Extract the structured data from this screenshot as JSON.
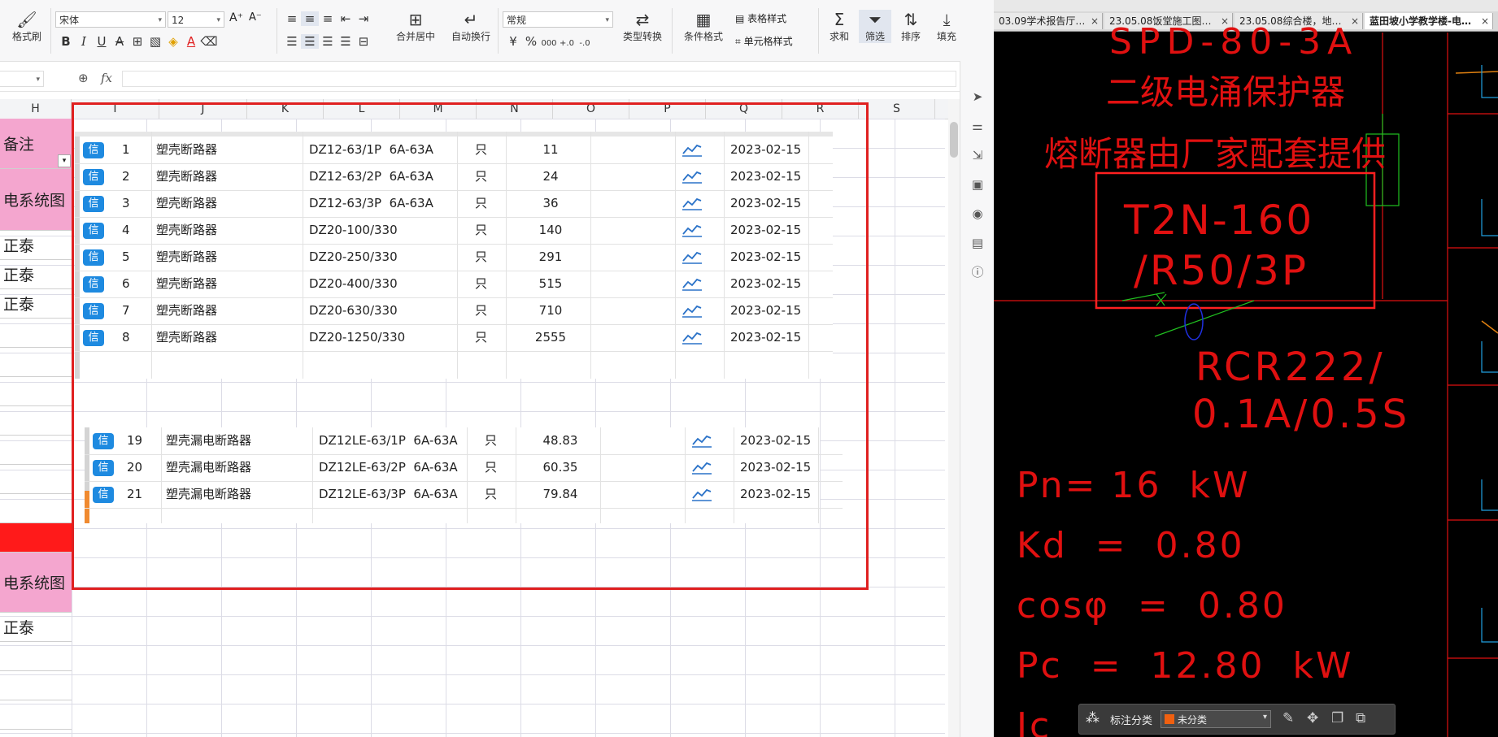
{
  "toolbar": {
    "format_painter": "格式刷",
    "font_name": "宋体",
    "font_size": "12",
    "number_format": "常规",
    "merge_center": "合并居中",
    "wrap_text": "自动换行",
    "type_convert": "类型转换",
    "conditional_format": "条件格式",
    "table_style": "表格样式",
    "cell_style": "单元格样式",
    "sum": "求和",
    "filter": "筛选",
    "sort": "排序",
    "fill": "填充",
    "percent": "%",
    "thousands": "000",
    "fx": "fx"
  },
  "columns": [
    "H",
    "I",
    "J",
    "K",
    "L",
    "M",
    "N",
    "O",
    "P",
    "Q",
    "R",
    "S"
  ],
  "h_column": [
    "备注",
    "电系统图",
    "正泰",
    "正泰",
    "正泰",
    "",
    "",
    "",
    "",
    "",
    "",
    "",
    "",
    "电系统图",
    "正泰"
  ],
  "table_top": {
    "rows": [
      {
        "no": "1",
        "name": "塑壳断路器",
        "model": "DZ12-63/1P  6A-63A",
        "unit": "只",
        "price": "11",
        "date": "2023-02-15"
      },
      {
        "no": "2",
        "name": "塑壳断路器",
        "model": "DZ12-63/2P  6A-63A",
        "unit": "只",
        "price": "24",
        "date": "2023-02-15"
      },
      {
        "no": "3",
        "name": "塑壳断路器",
        "model": "DZ12-63/3P  6A-63A",
        "unit": "只",
        "price": "36",
        "date": "2023-02-15"
      },
      {
        "no": "4",
        "name": "塑壳断路器",
        "model": "DZ20-100/330",
        "unit": "只",
        "price": "140",
        "date": "2023-02-15"
      },
      {
        "no": "5",
        "name": "塑壳断路器",
        "model": "DZ20-250/330",
        "unit": "只",
        "price": "291",
        "date": "2023-02-15"
      },
      {
        "no": "6",
        "name": "塑壳断路器",
        "model": "DZ20-400/330",
        "unit": "只",
        "price": "515",
        "date": "2023-02-15"
      },
      {
        "no": "7",
        "name": "塑壳断路器",
        "model": "DZ20-630/330",
        "unit": "只",
        "price": "710",
        "date": "2023-02-15"
      },
      {
        "no": "8",
        "name": "塑壳断路器",
        "model": "DZ20-1250/330",
        "unit": "只",
        "price": "2555",
        "date": "2023-02-15"
      }
    ]
  },
  "table_bottom": {
    "rows": [
      {
        "no": "19",
        "name": "塑壳漏电断路器",
        "model": "DZ12LE-63/1P  6A-63A",
        "unit": "只",
        "price": "48.83",
        "date": "2023-02-15"
      },
      {
        "no": "20",
        "name": "塑壳漏电断路器",
        "model": "DZ12LE-63/2P  6A-63A",
        "unit": "只",
        "price": "60.35",
        "date": "2023-02-15"
      },
      {
        "no": "21",
        "name": "塑壳漏电断路器",
        "model": "DZ12LE-63/3P  6A-63A",
        "unit": "只",
        "price": "79.84",
        "date": "2023-02-15"
      }
    ]
  },
  "badge_label": "信",
  "cad": {
    "tabs": [
      {
        "label": "03.09学术报告厅…"
      },
      {
        "label": "23.05.08饭堂施工图…"
      },
      {
        "label": "23.05.08综合楼，地…"
      },
      {
        "label": "蓝田坡小学教学楼-电…"
      }
    ],
    "texts": {
      "spd": "SPD-80-3A",
      "surge": "二级电涌保护器",
      "fuse": "熔断器由厂家配套提供",
      "breaker1": "T2N-160",
      "breaker2": "/R50/3P",
      "rcr1": "RCR222/",
      "rcr2": "0.1A/0.5S",
      "pn": "Pn= 16  kW",
      "kd": "Kd  =  0.80",
      "cos": "cosφ  =  0.80",
      "pc": "Pc  =  12.80  kW",
      "ic": "Ic"
    },
    "status": {
      "label": "标注分类",
      "value": "未分类"
    }
  },
  "colors": {
    "accent_blue": "#1e8ae0",
    "cad_red": "#e01010",
    "highlight_pink": "#f4a6cf",
    "red_fill": "#ff1a1a",
    "selection_border": "#e02020"
  }
}
